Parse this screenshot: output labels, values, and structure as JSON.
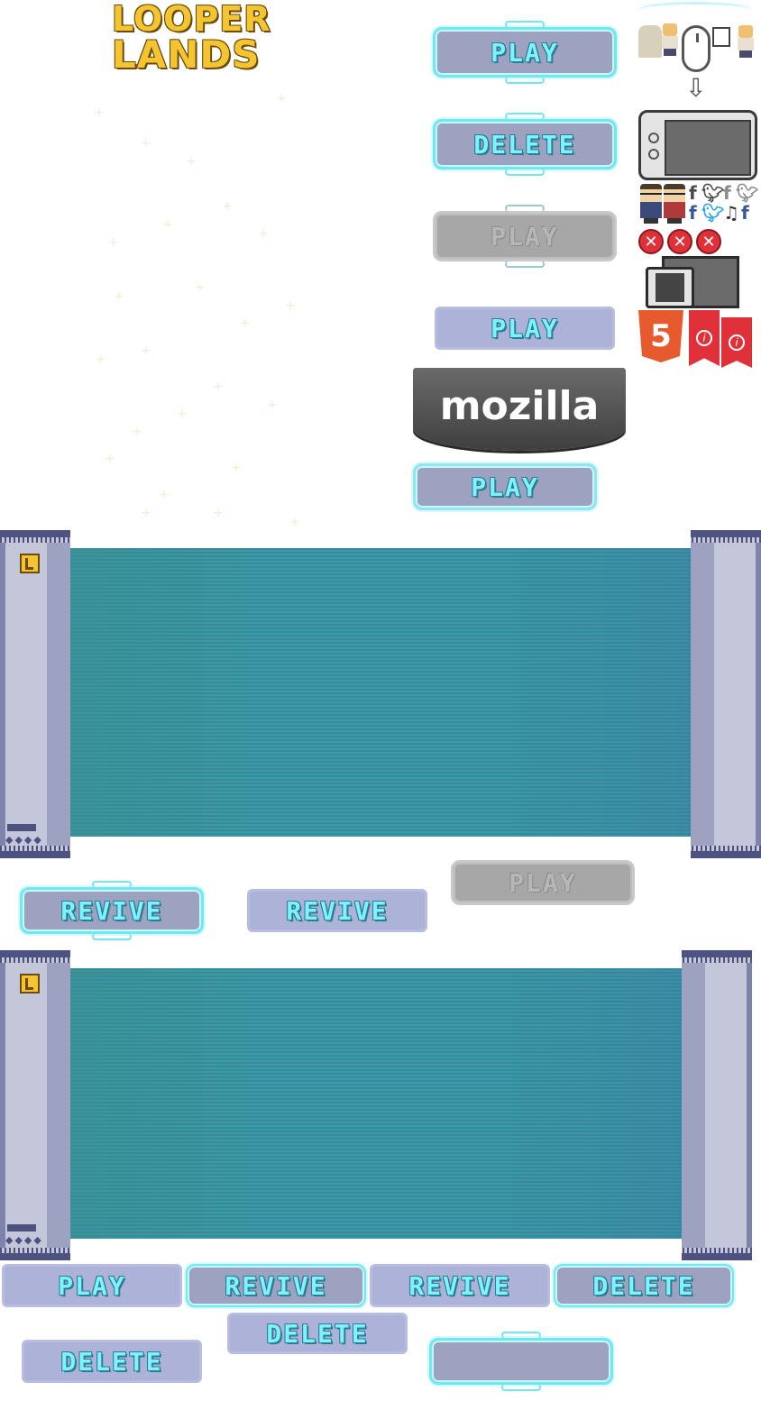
{
  "logo": {
    "line1": "LOOPER",
    "line2": "LANDS"
  },
  "buttons": {
    "play": "PLAY",
    "delete": "DELETE",
    "revive": "REVIVE",
    "empty": ""
  },
  "mozilla": {
    "label": "mozilla"
  },
  "sprites": {
    "html5_label": "5",
    "info_glyph": "i",
    "close_glyph": "✕",
    "social_icons": [
      "facebook-icon",
      "twitter-icon",
      "music-note-icon"
    ]
  },
  "colors": {
    "button_fill": "#9da2c0",
    "button_glow": "#6fe8f4",
    "label_cyan": "#7ef3ff",
    "screen_teal": "#3c9aa8",
    "logo_gold": "#f4c531",
    "mozilla_gray": "#555555"
  }
}
